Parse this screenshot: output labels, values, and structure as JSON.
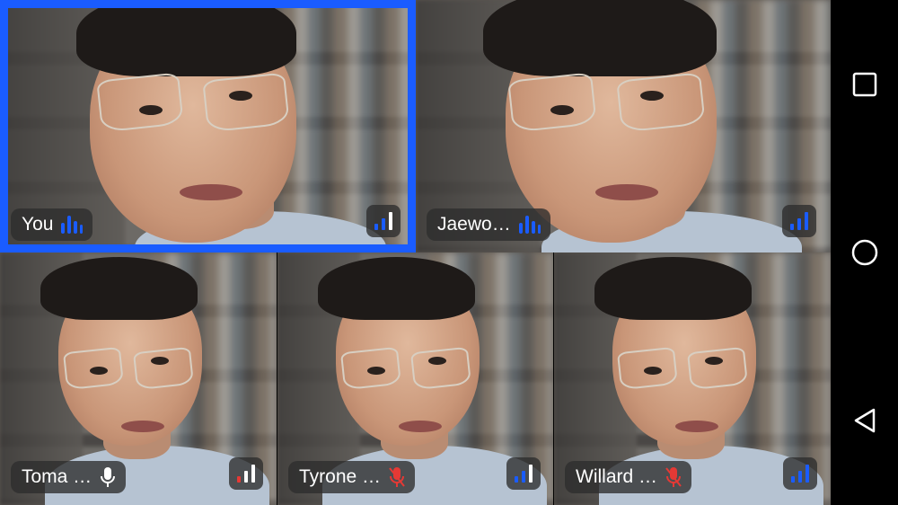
{
  "participants": [
    {
      "name": "You",
      "audio": "speaking",
      "signal": "good",
      "selected": true
    },
    {
      "name": "Jaewo…",
      "audio": "speaking",
      "signal": "good",
      "selected": false
    },
    {
      "name": "Toma …",
      "audio": "mic-on",
      "signal": "weak",
      "selected": false
    },
    {
      "name": "Tyrone …",
      "audio": "muted",
      "signal": "good",
      "selected": false
    },
    {
      "name": "Willard …",
      "audio": "muted",
      "signal": "good",
      "selected": false
    }
  ],
  "colors": {
    "accent": "#1a5cff",
    "signal_good": "#1a5cff",
    "signal_weak": "#e53935",
    "muted": "#e53935"
  },
  "navbar": {
    "recents_icon": "square-icon",
    "home_icon": "circle-icon",
    "back_icon": "triangle-back-icon"
  }
}
